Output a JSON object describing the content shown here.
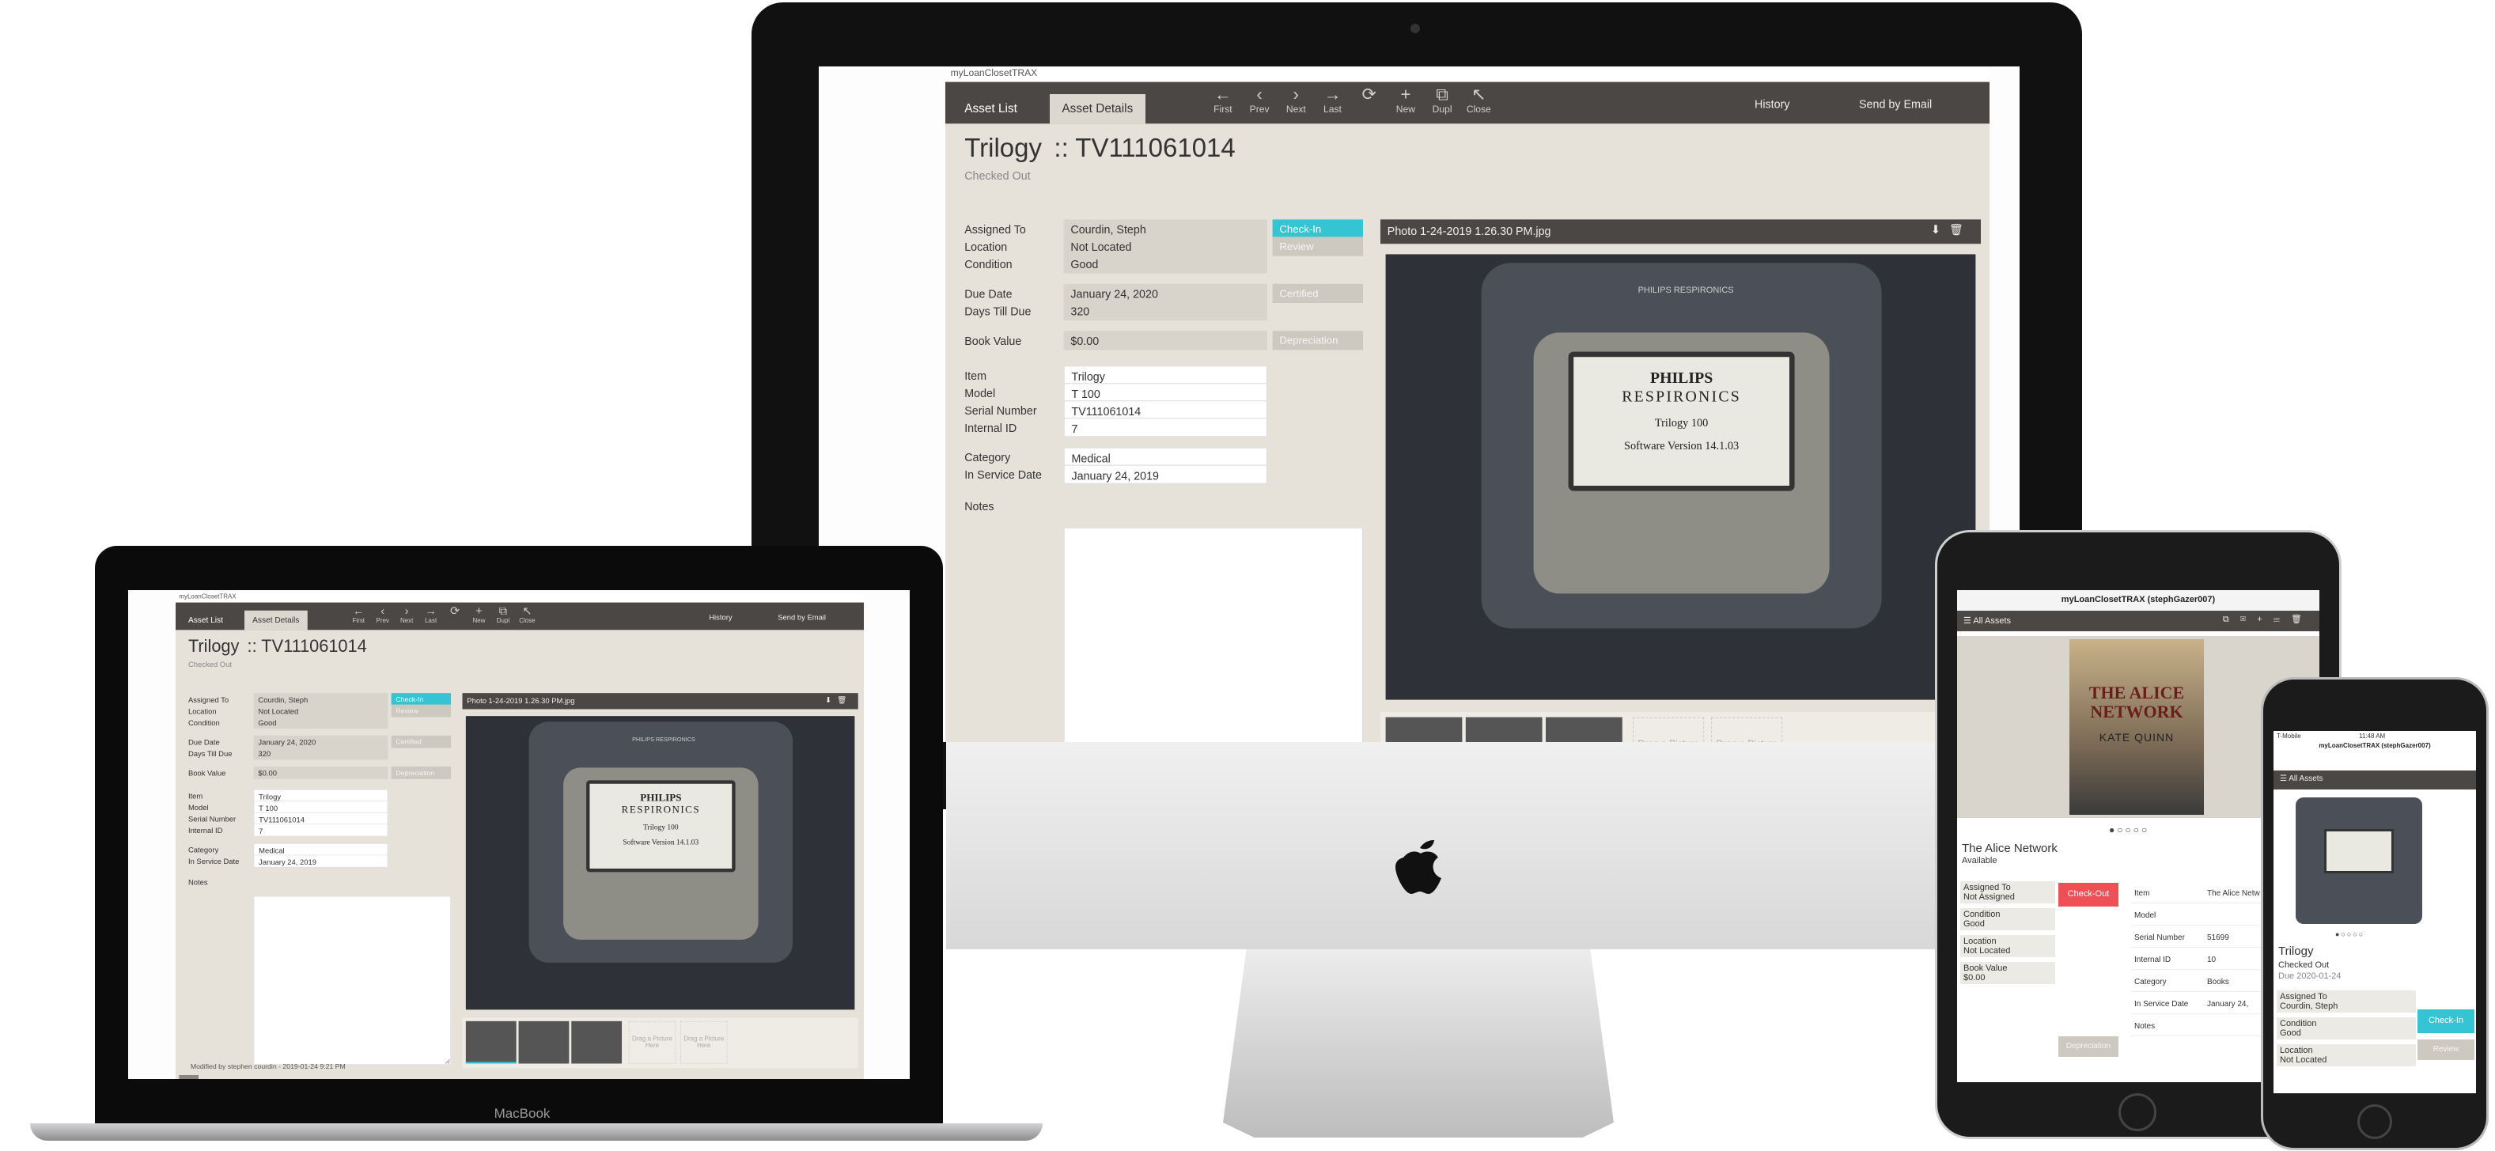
{
  "app": {
    "window_title": "myLoanClosetTRAX",
    "tabs": [
      "Asset List",
      "Asset Details"
    ],
    "toolbar": [
      "First",
      "Prev",
      "Next",
      "Last",
      "",
      "New",
      "Dupl",
      "Close"
    ],
    "right_actions": [
      "History",
      "Send by Email"
    ],
    "asset_name": "Trilogy",
    "asset_id": ":: TV111061014",
    "status": "Checked Out",
    "fields": [
      {
        "label": "Assigned To",
        "value": "Courdin, Steph",
        "button": "Check-In",
        "button_style": "teal"
      },
      {
        "label": "Location",
        "value": "Not Located",
        "button": "Review",
        "button_style": "grey"
      },
      {
        "label": "Condition",
        "value": "Good"
      },
      {
        "label": "Due Date",
        "value": "January 24, 2020",
        "button": "Certified",
        "button_style": "grey"
      },
      {
        "label": "Days Till Due",
        "value": "320"
      },
      {
        "label": "Book Value",
        "value": "$0.00",
        "button": "Depreciation",
        "button_style": "grey"
      },
      {
        "label": "Item",
        "value": "Trilogy"
      },
      {
        "label": "Model",
        "value": "T 100"
      },
      {
        "label": "Serial Number",
        "value": "TV111061014"
      },
      {
        "label": "Internal ID",
        "value": "7"
      },
      {
        "label": "Category",
        "value": "Medical"
      },
      {
        "label": "In Service Date",
        "value": "January 24, 2019"
      },
      {
        "label": "Notes",
        "value": ""
      }
    ],
    "photo_title": "Photo 1-24-2019 1.26.30 PM.jpg",
    "drop_text": "Drag a Picture Here",
    "footer": "Modified by stephen courdin - 2019-01-24 9:21 PM",
    "device_lcd": [
      "PHILIPS",
      "RESPIRONICS",
      "Trilogy 100",
      "Software Version 14.1.03"
    ],
    "device_brand": "PHILIPS RESPIRONICS"
  },
  "macbook_label": "MacBook",
  "ipad": {
    "header": "myLoanClosetTRAX (stephGazer007)",
    "bar": "All Assets",
    "title": "The Alice Network",
    "status": "Available",
    "book_title": "THE ALICE NETWORK",
    "book_author": "KATE QUINN",
    "left_fields": [
      {
        "label": "Assigned To",
        "value": "Not Assigned"
      },
      {
        "label": "Condition",
        "value": "Good"
      },
      {
        "label": "Location",
        "value": "Not Located"
      },
      {
        "label": "Book Value",
        "value": "$0.00"
      }
    ],
    "checkout": "Check-Out",
    "depreciation": "Depreciation",
    "right_fields": [
      {
        "label": "Item",
        "value": "The Alice Netw"
      },
      {
        "label": "Model",
        "value": ""
      },
      {
        "label": "Serial Number",
        "value": "51699"
      },
      {
        "label": "Internal ID",
        "value": "10"
      },
      {
        "label": "Category",
        "value": "Books"
      },
      {
        "label": "In Service Date",
        "value": "January 24,"
      },
      {
        "label": "Notes",
        "value": ""
      }
    ]
  },
  "iphone": {
    "carrier": "T-Mobile",
    "time": "11:48 AM",
    "header": "myLoanClosetTRAX (stephGazer007)",
    "bar": "All Assets",
    "title": "Trilogy",
    "status": "Checked Out",
    "due": "Due 2020-01-24",
    "fields": [
      {
        "label": "Assigned To",
        "value": "Courdin, Steph"
      },
      {
        "label": "Condition",
        "value": "Good"
      },
      {
        "label": "Location",
        "value": "Not Located"
      }
    ],
    "checkin": "Check-In",
    "review": "Review"
  }
}
